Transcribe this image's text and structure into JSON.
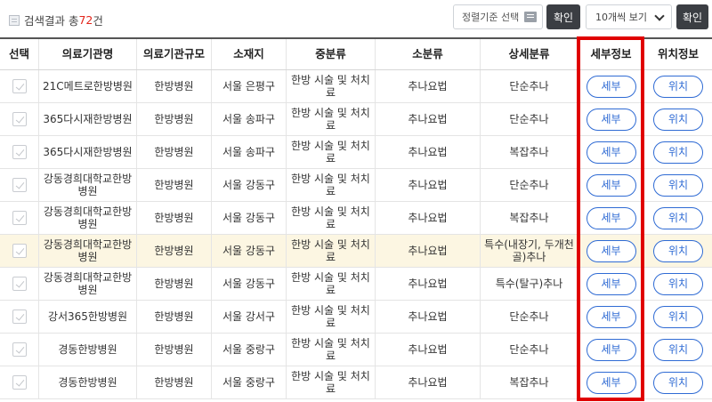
{
  "header": {
    "result_prefix": "검색결과 총",
    "result_count": "72",
    "result_suffix": "건",
    "sort_label": "정렬기준 선택",
    "confirm_label": "확인",
    "page_size_label": "10개씩 보기",
    "confirm2_label": "확인"
  },
  "columns": [
    "선택",
    "의료기관명",
    "의료기관규모",
    "소재지",
    "중분류",
    "소분류",
    "상세분류",
    "세부정보",
    "위치정보"
  ],
  "rows": [
    {
      "name": "21C메트로한방병원",
      "size": "한방병원",
      "location": "서울 은평구",
      "mid": "한방 시술 및 처치료",
      "small": "추나요법",
      "detail": "단순추나",
      "btn_detail": "세부",
      "btn_loc": "위치"
    },
    {
      "name": "365다시재한방병원",
      "size": "한방병원",
      "location": "서울 송파구",
      "mid": "한방 시술 및 처치료",
      "small": "추나요법",
      "detail": "단순추나",
      "btn_detail": "세부",
      "btn_loc": "위치"
    },
    {
      "name": "365다시재한방병원",
      "size": "한방병원",
      "location": "서울 송파구",
      "mid": "한방 시술 및 처치료",
      "small": "추나요법",
      "detail": "복잡추나",
      "btn_detail": "세부",
      "btn_loc": "위치"
    },
    {
      "name": "강동경희대학교한방병원",
      "size": "한방병원",
      "location": "서울 강동구",
      "mid": "한방 시술 및 처치료",
      "small": "추나요법",
      "detail": "단순추나",
      "btn_detail": "세부",
      "btn_loc": "위치"
    },
    {
      "name": "강동경희대학교한방병원",
      "size": "한방병원",
      "location": "서울 강동구",
      "mid": "한방 시술 및 처치료",
      "small": "추나요법",
      "detail": "복잡추나",
      "btn_detail": "세부",
      "btn_loc": "위치"
    },
    {
      "name": "강동경희대학교한방병원",
      "size": "한방병원",
      "location": "서울 강동구",
      "mid": "한방 시술 및 처치료",
      "small": "추나요법",
      "detail": "특수(내장기, 두개천골)추나",
      "btn_detail": "세부",
      "btn_loc": "위치"
    },
    {
      "name": "강동경희대학교한방병원",
      "size": "한방병원",
      "location": "서울 강동구",
      "mid": "한방 시술 및 처치료",
      "small": "추나요법",
      "detail": "특수(탈구)추나",
      "btn_detail": "세부",
      "btn_loc": "위치"
    },
    {
      "name": "강서365한방병원",
      "size": "한방병원",
      "location": "서울 강서구",
      "mid": "한방 시술 및 처치료",
      "small": "추나요법",
      "detail": "단순추나",
      "btn_detail": "세부",
      "btn_loc": "위치"
    },
    {
      "name": "경동한방병원",
      "size": "한방병원",
      "location": "서울 중랑구",
      "mid": "한방 시술 및 처치료",
      "small": "추나요법",
      "detail": "단순추나",
      "btn_detail": "세부",
      "btn_loc": "위치"
    },
    {
      "name": "경동한방병원",
      "size": "한방병원",
      "location": "서울 중랑구",
      "mid": "한방 시술 및 처치료",
      "small": "추나요법",
      "detail": "복잡추나",
      "btn_detail": "세부",
      "btn_loc": "위치"
    }
  ],
  "highlighted_row_index": 5,
  "colors": {
    "accent": "#2f6bd4",
    "count": "#e2261c",
    "highlight": "#fcf6e2",
    "frame": "#e00000",
    "dark_button": "#3b3e43"
  }
}
